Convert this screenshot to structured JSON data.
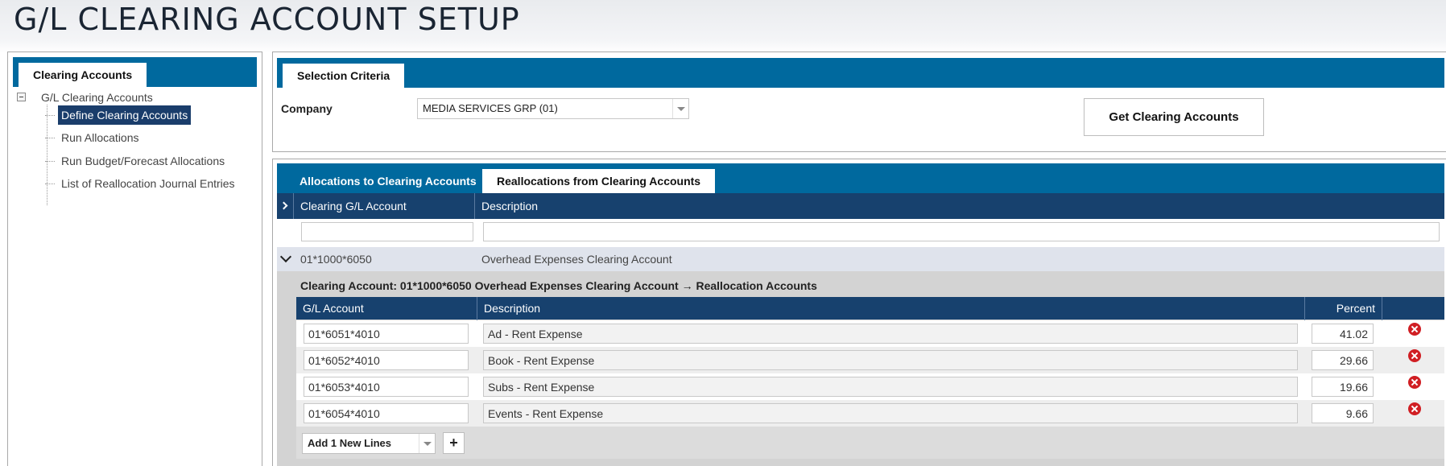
{
  "page": {
    "title": "G/L CLEARING ACCOUNT SETUP"
  },
  "left_panel": {
    "tab_label": "Clearing Accounts",
    "tree": {
      "root_label": "G/L Clearing Accounts",
      "children": [
        {
          "label": "Define Clearing Accounts",
          "selected": true
        },
        {
          "label": "Run Allocations",
          "selected": false
        },
        {
          "label": "Run Budget/Forecast Allocations",
          "selected": false
        },
        {
          "label": "List of Reallocation Journal Entries",
          "selected": false
        }
      ]
    }
  },
  "selection": {
    "tab_label": "Selection Criteria",
    "company_label": "Company",
    "company_value": "MEDIA SERVICES GRP (01)",
    "get_button_label": "Get Clearing Accounts"
  },
  "main": {
    "tabs": [
      {
        "label": "Allocations to Clearing Accounts",
        "active": false
      },
      {
        "label": "Reallocations from Clearing Accounts",
        "active": true
      }
    ],
    "columns": [
      "Clearing G/L Account",
      "Description"
    ],
    "row": {
      "account": "01*1000*6050",
      "description": "Overhead Expenses Clearing Account"
    },
    "detail": {
      "title": "Clearing Account: 01*1000*6050 Overhead Expenses Clearing Account → Reallocation Accounts",
      "columns": [
        "G/L Account",
        "Description",
        "Percent"
      ],
      "rows": [
        {
          "account": "01*6051*4010",
          "description": "Ad - Rent Expense",
          "percent": "41.02"
        },
        {
          "account": "01*6052*4010",
          "description": "Book - Rent Expense",
          "percent": "29.66"
        },
        {
          "account": "01*6053*4010",
          "description": "Subs - Rent Expense",
          "percent": "19.66"
        },
        {
          "account": "01*6054*4010",
          "description": "Events - Rent Expense",
          "percent": "9.66"
        }
      ],
      "add_lines_value": "Add 1 New Lines",
      "plus_label": "+"
    }
  },
  "colors": {
    "tab_bar": "#00699e",
    "grid_header": "#17416e",
    "selected": "#1a3d6b",
    "delete": "#d01e23"
  }
}
